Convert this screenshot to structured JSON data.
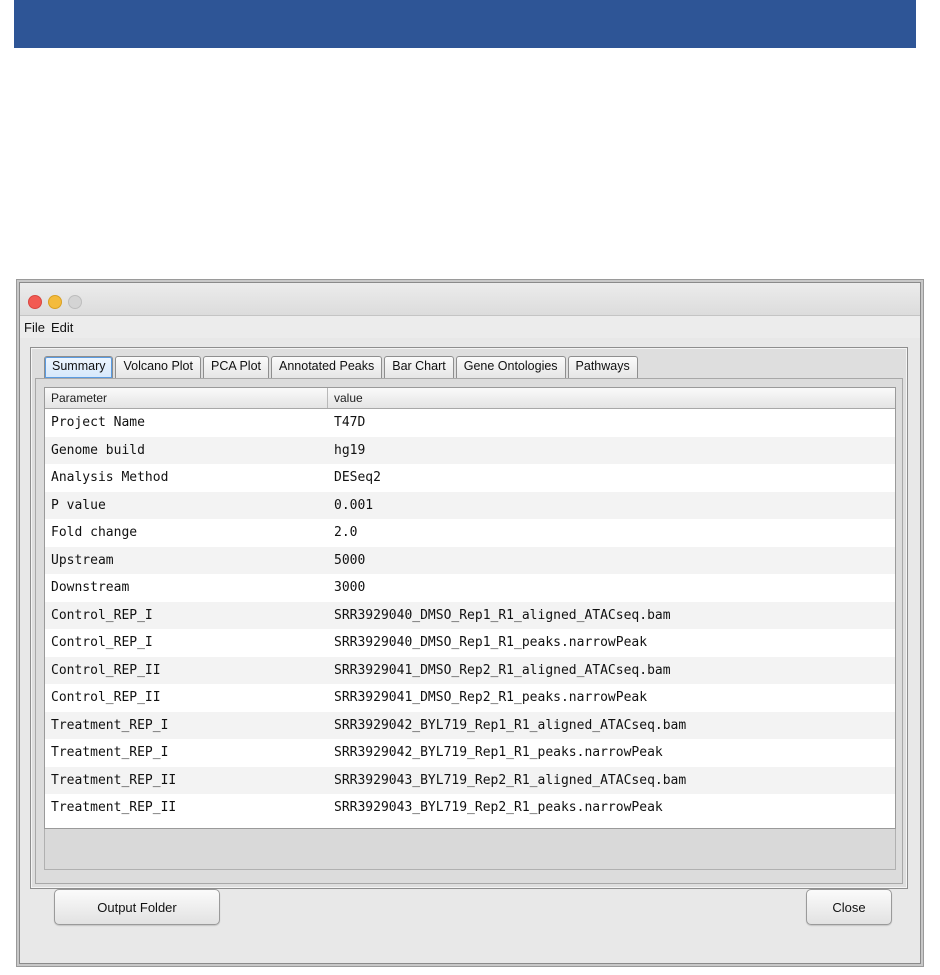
{
  "window": {
    "menu": [
      "File",
      "Edit"
    ],
    "traffic_lights": {
      "close": "#f25a52",
      "minimize": "#f4bb3c",
      "zoom": "#d4d4d4"
    }
  },
  "tabs": [
    "Summary",
    "Volcano Plot",
    "PCA Plot",
    "Annotated Peaks",
    "Bar Chart",
    "Gene Ontologies",
    "Pathways"
  ],
  "active_tab": "Summary",
  "table": {
    "headers": [
      "Parameter",
      "value"
    ],
    "rows": [
      [
        "Project Name",
        "T47D"
      ],
      [
        "Genome build",
        "hg19"
      ],
      [
        "Analysis Method",
        "DESeq2"
      ],
      [
        "P value",
        "0.001"
      ],
      [
        "Fold change",
        "2.0"
      ],
      [
        "Upstream",
        "5000"
      ],
      [
        "Downstream",
        "3000"
      ],
      [
        "Control_REP_I",
        "SRR3929040_DMSO_Rep1_R1_aligned_ATACseq.bam"
      ],
      [
        "Control_REP_I",
        "SRR3929040_DMSO_Rep1_R1_peaks.narrowPeak"
      ],
      [
        "Control_REP_II",
        "SRR3929041_DMSO_Rep2_R1_aligned_ATACseq.bam"
      ],
      [
        "Control_REP_II",
        "SRR3929041_DMSO_Rep2_R1_peaks.narrowPeak"
      ],
      [
        "Treatment_REP_I",
        "SRR3929042_BYL719_Rep1_R1_aligned_ATACseq.bam"
      ],
      [
        "Treatment_REP_I",
        "SRR3929042_BYL719_Rep1_R1_peaks.narrowPeak"
      ],
      [
        "Treatment_REP_II",
        "SRR3929043_BYL719_Rep2_R1_aligned_ATACseq.bam"
      ],
      [
        "Treatment_REP_II",
        "SRR3929043_BYL719_Rep2_R1_peaks.narrowPeak"
      ]
    ]
  },
  "buttons": {
    "output_folder": "Output Folder",
    "close": "Close"
  },
  "colors": {
    "banner": "#2e5596",
    "tab_active": "#d6e8fb"
  }
}
